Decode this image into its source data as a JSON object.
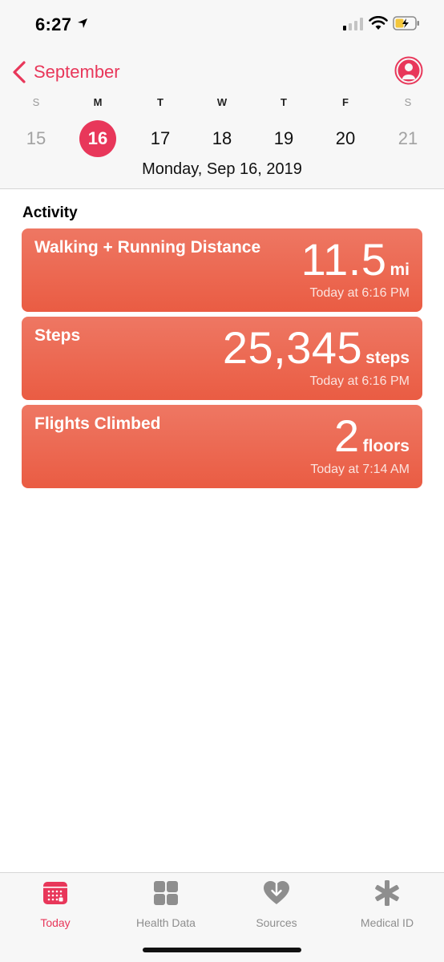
{
  "status": {
    "time": "6:27",
    "signal_bars": 1,
    "battery": "charging"
  },
  "nav": {
    "back_label": "September",
    "profile_icon": "profile-icon"
  },
  "week": {
    "days": [
      {
        "letter": "S",
        "number": "15"
      },
      {
        "letter": "M",
        "number": "16"
      },
      {
        "letter": "T",
        "number": "17"
      },
      {
        "letter": "W",
        "number": "18"
      },
      {
        "letter": "T",
        "number": "19"
      },
      {
        "letter": "F",
        "number": "20"
      },
      {
        "letter": "S",
        "number": "21"
      }
    ],
    "selected_index": 1,
    "full_date": "Monday, Sep 16, 2019"
  },
  "activity": {
    "title": "Activity",
    "cards": [
      {
        "title": "Walking + Running Distance",
        "value": "11.5",
        "unit": "mi",
        "time": "Today at 6:16 PM"
      },
      {
        "title": "Steps",
        "value": "25,345",
        "unit": "steps",
        "time": "Today at 6:16 PM"
      },
      {
        "title": "Flights Climbed",
        "value": "2",
        "unit": "floors",
        "time": "Today at 7:14 AM"
      }
    ]
  },
  "tabs": [
    {
      "label": "Today",
      "icon": "calendar-icon",
      "active": true
    },
    {
      "label": "Health Data",
      "icon": "grid-icon",
      "active": false
    },
    {
      "label": "Sources",
      "icon": "heart-download-icon",
      "active": false
    },
    {
      "label": "Medical ID",
      "icon": "asterisk-icon",
      "active": false
    }
  ],
  "colors": {
    "accent": "#e8375a",
    "card": "#ec6a52",
    "inactive": "#8e8e8e"
  }
}
